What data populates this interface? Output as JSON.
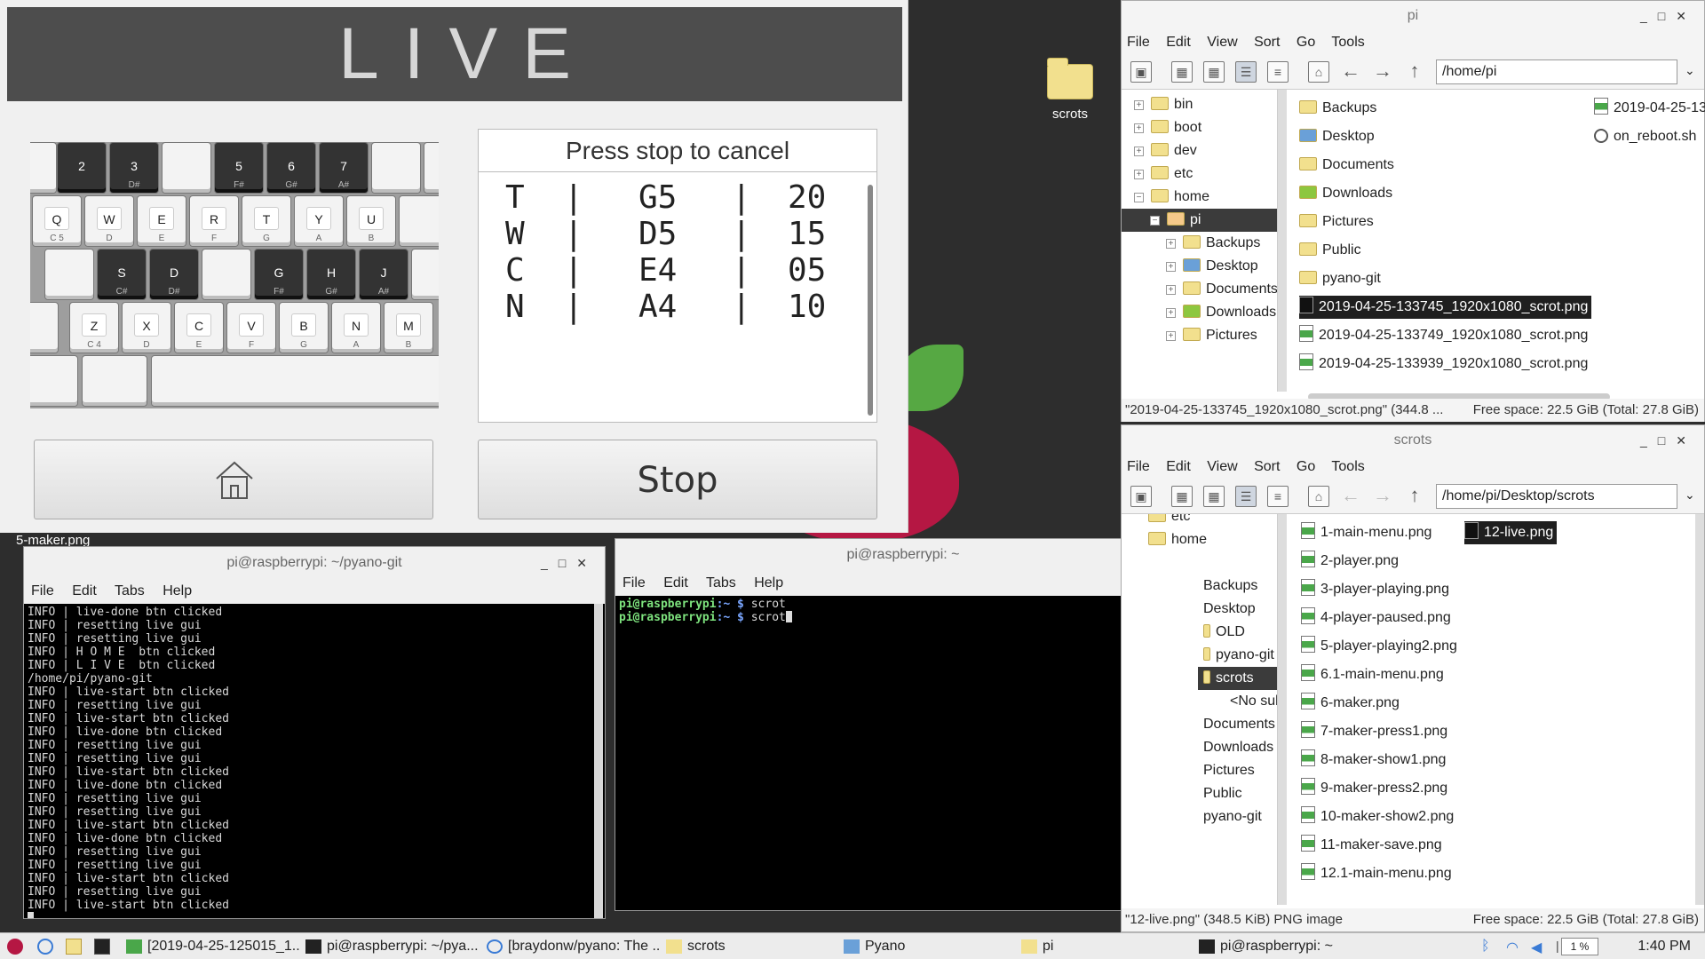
{
  "desktop": {
    "icon_label": "scrots",
    "partial_label": "5-maker.png"
  },
  "pyano_live": {
    "banner": "LIVE",
    "prompt": "Press stop to cancel",
    "rows": [
      {
        "key": "T",
        "sep1": "|",
        "note": "G5",
        "sep2": "|",
        "value": "20"
      },
      {
        "key": "W",
        "sep1": "|",
        "note": "D5",
        "sep2": "|",
        "value": "15"
      },
      {
        "key": "C",
        "sep1": "|",
        "note": "E4",
        "sep2": "|",
        "value": "05"
      },
      {
        "key": "N",
        "sep1": "|",
        "note": "A4",
        "sep2": "|",
        "value": "10"
      }
    ],
    "stop_label": "Stop",
    "keyboard": {
      "row1": [
        "2",
        "3",
        "5",
        "6",
        "7"
      ],
      "row1_sub": [
        "",
        "D#",
        "F#",
        "G#",
        "A#"
      ],
      "row2": [
        "Q",
        "W",
        "E",
        "R",
        "T",
        "Y",
        "U"
      ],
      "row2_sub": [
        "C 5",
        "D",
        "E",
        "F",
        "G",
        "A",
        "B"
      ],
      "row3": [
        "S",
        "D",
        "G",
        "H",
        "J"
      ],
      "row3_sub": [
        "C#",
        "D#",
        "F#",
        "G#",
        "A#"
      ],
      "row4": [
        "Z",
        "X",
        "C",
        "V",
        "B",
        "N",
        "M"
      ],
      "row4_sub": [
        "C 4",
        "D",
        "E",
        "F",
        "G",
        "A",
        "B"
      ]
    }
  },
  "terminal1": {
    "title": "pi@raspberrypi: ~/pyano-git",
    "menu": [
      "File",
      "Edit",
      "Tabs",
      "Help"
    ],
    "lines": [
      "INFO | live-done btn clicked",
      "INFO | resetting live gui",
      "INFO | resetting live gui",
      "INFO | H O M E  btn clicked",
      "INFO | L I V E  btn clicked",
      "/home/pi/pyano-git",
      "INFO | live-start btn clicked",
      "INFO | resetting live gui",
      "INFO | live-start btn clicked",
      "INFO | live-done btn clicked",
      "INFO | resetting live gui",
      "INFO | resetting live gui",
      "INFO | live-start btn clicked",
      "INFO | live-done btn clicked",
      "INFO | resetting live gui",
      "INFO | resetting live gui",
      "INFO | live-start btn clicked",
      "INFO | live-done btn clicked",
      "INFO | resetting live gui",
      "INFO | resetting live gui",
      "INFO | live-start btn clicked",
      "INFO | resetting live gui",
      "INFO | live-start btn clicked"
    ]
  },
  "terminal2": {
    "title": "pi@raspberrypi: ~",
    "menu": [
      "File",
      "Edit",
      "Tabs",
      "Help"
    ],
    "prompt_user": "pi@raspberrypi",
    "prompt_path": ":~ $",
    "cmd1": " scrot",
    "cmd2": " scrot"
  },
  "fm_home": {
    "title": "pi",
    "menu": [
      "File",
      "Edit",
      "View",
      "Sort",
      "Go",
      "Tools"
    ],
    "path": "/home/pi",
    "tree": [
      "bin",
      "boot",
      "dev",
      "etc",
      "home",
      "pi",
      "Backups",
      "Desktop",
      "Documents",
      "Downloads",
      "Pictures"
    ],
    "files_col1": [
      "Backups",
      "Desktop",
      "Documents",
      "Downloads",
      "Pictures",
      "Public",
      "pyano-git"
    ],
    "images": [
      "2019-04-25-133745_1920x1080_scrot.png",
      "2019-04-25-133749_1920x1080_scrot.png",
      "2019-04-25-133939_1920x1080_scrot.png"
    ],
    "files_col2": [
      "2019-04-25-13",
      "on_reboot.sh"
    ],
    "status_left": "\"2019-04-25-133745_1920x1080_scrot.png\" (344.8 ...",
    "status_right": "Free space: 22.5 GiB (Total: 27.8 GiB)"
  },
  "fm_scrots": {
    "title": "scrots",
    "menu": [
      "File",
      "Edit",
      "View",
      "Sort",
      "Go",
      "Tools"
    ],
    "path": "/home/pi/Desktop/scrots",
    "tree": [
      "etc",
      "home",
      "Backups",
      "Desktop",
      "OLD",
      "pyano-git",
      "scrots",
      "<No sub",
      "Documents",
      "Downloads",
      "Pictures",
      "Public",
      "pyano-git"
    ],
    "files": [
      "1-main-menu.png",
      "2-player.png",
      "3-player-playing.png",
      "4-player-paused.png",
      "5-player-playing2.png",
      "6.1-main-menu.png",
      "6-maker.png",
      "7-maker-press1.png",
      "8-maker-show1.png",
      "9-maker-press2.png",
      "10-maker-show2.png",
      "11-maker-save.png",
      "12.1-main-menu.png"
    ],
    "selected_file": "12-live.png",
    "status_left": "\"12-live.png\" (348.5 KiB) PNG image",
    "status_right": "Free space: 22.5 GiB (Total: 27.8 GiB)"
  },
  "taskbar": {
    "tasks": [
      "[2019-04-25-125015_1...",
      "pi@raspberrypi: ~/pya...",
      "[braydonw/pyano: The ...",
      "scrots",
      "Pyano",
      "pi",
      "pi@raspberrypi: ~"
    ],
    "cpu": "1 %",
    "clock": "1:40 PM"
  },
  "colors": {
    "banner_bg": "#4d4d4d",
    "prompt_green": "#7ee37e",
    "rpi_red": "#b51743",
    "rpi_green": "#56a843"
  }
}
